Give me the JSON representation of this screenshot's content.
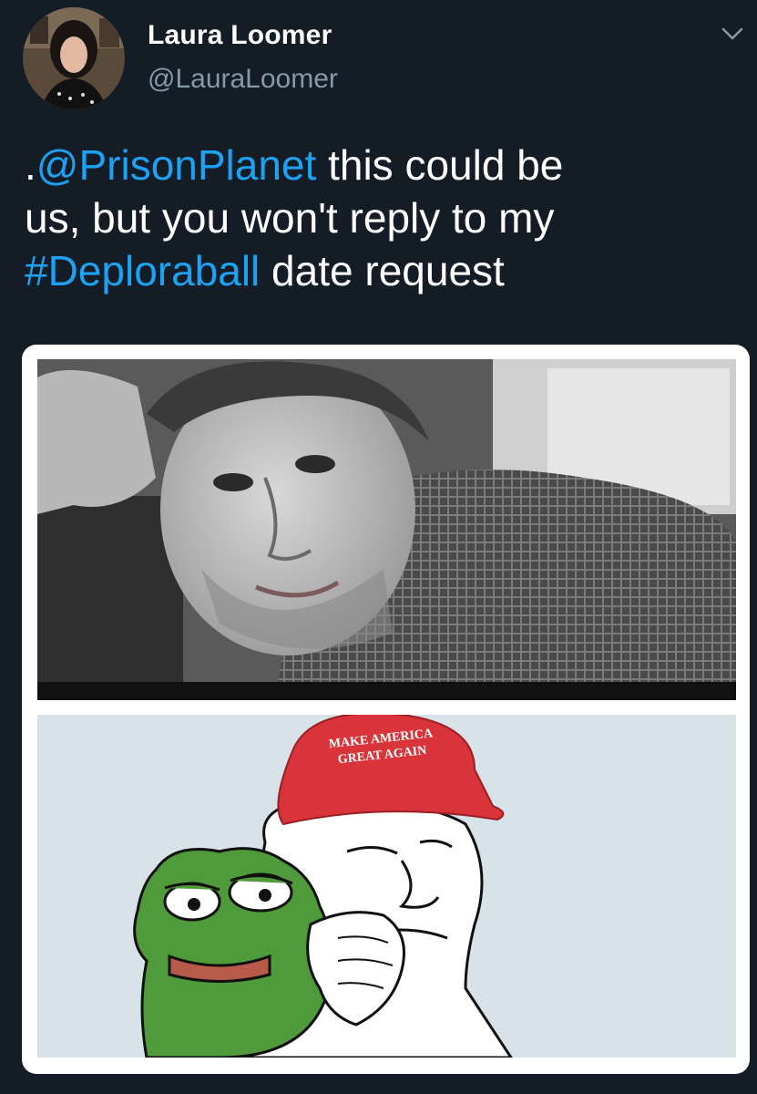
{
  "author": {
    "display_name": "Laura Loomer",
    "handle": "@LauraLoomer",
    "avatar_icon": "profile-photo"
  },
  "tweet": {
    "prefix": ".",
    "mention": "@PrisonPlanet",
    "text_1": " this could be\nus, but you won't reply to my\n",
    "hashtag": "#Deploraball",
    "text_2": " date request"
  },
  "media": {
    "hat_line_1": "MAKE AMERICA",
    "hat_line_2": "GREAT AGAIN"
  },
  "colors": {
    "background": "#141d26",
    "link": "#1da1f2",
    "secondary_text": "#8899a6",
    "hat_red": "#d8343a",
    "frog_green": "#4f9a3a"
  }
}
